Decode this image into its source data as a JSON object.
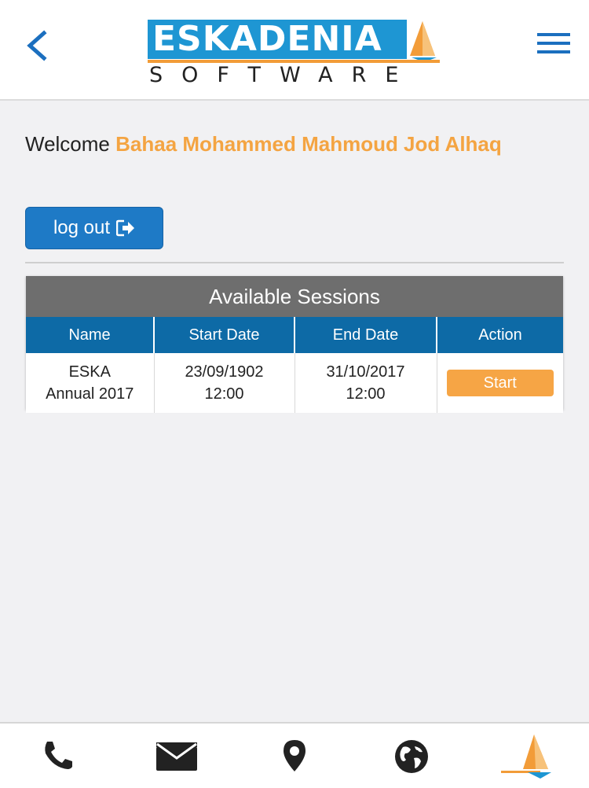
{
  "header": {
    "logo_text": "ESKADENIA",
    "logo_subtext": "SOFTWARE",
    "back_icon": "chevron-left-icon",
    "menu_icon": "hamburger-menu-icon",
    "accent_color": "#1e96d3",
    "brand_orange": "#f29c38"
  },
  "welcome": {
    "prefix": "Welcome",
    "user_name": "Bahaa Mohammed Mahmoud Jod Alhaq"
  },
  "logout": {
    "label": "log out",
    "icon": "sign-out-icon"
  },
  "sessions": {
    "title": "Available Sessions",
    "columns": [
      "Name",
      "Start Date",
      "End Date",
      "Action"
    ],
    "rows": [
      {
        "name_line1": "ESKA",
        "name_line2": "Annual 2017",
        "start_date": "23/09/1902",
        "start_time": "12:00",
        "end_date": "31/10/2017",
        "end_time": "12:00",
        "action": "Start"
      }
    ]
  },
  "footer": {
    "icons": [
      "phone-icon",
      "mail-icon",
      "location-pin-icon",
      "globe-icon",
      "sail-logo-icon"
    ]
  }
}
